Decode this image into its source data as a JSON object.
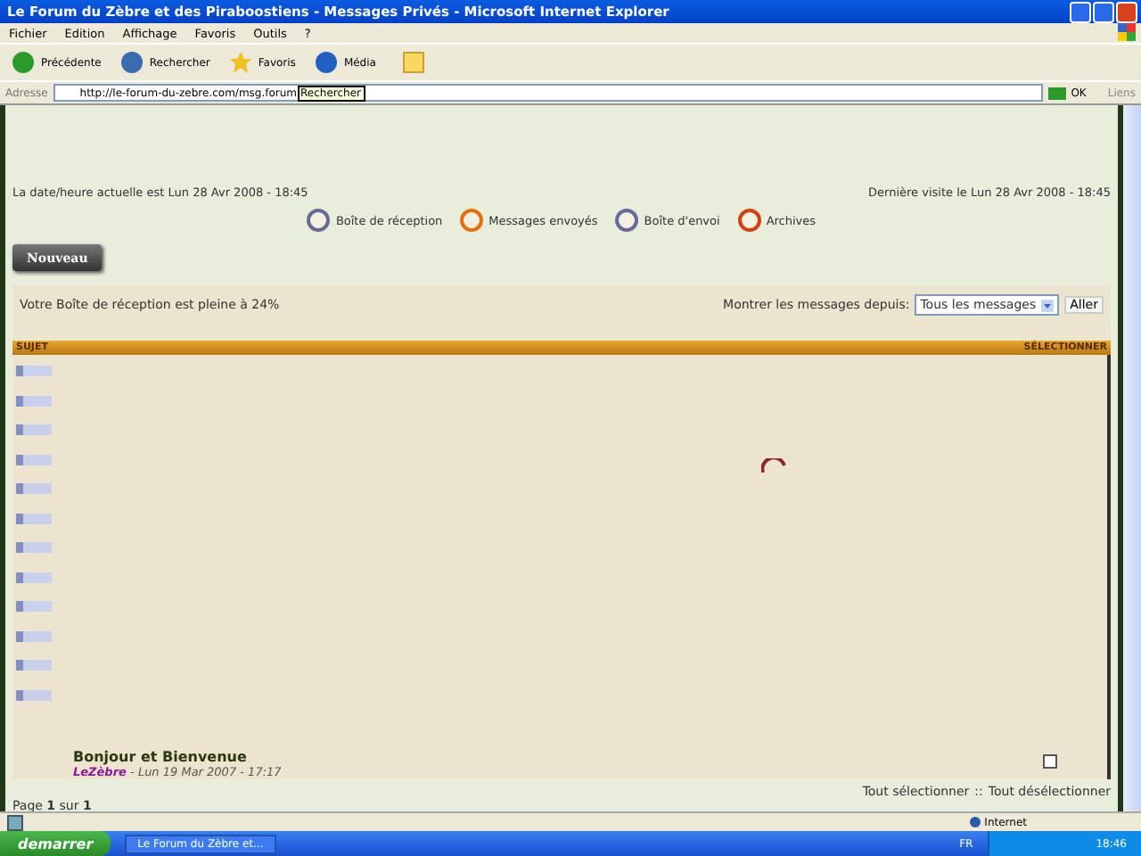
{
  "window": {
    "title": "Le Forum du Zèbre et des Piraboostiens - Messages Privés - Microsoft Internet Explorer"
  },
  "menu": [
    "Fichier",
    "Edition",
    "Affichage",
    "Favoris",
    "Outils",
    "?"
  ],
  "toolbar": [
    {
      "kind": "back",
      "label": "Précédente"
    },
    {
      "kind": "search",
      "label": "Rechercher"
    },
    {
      "kind": "favorites",
      "label": "Favoris"
    },
    {
      "kind": "media",
      "label": "Média"
    }
  ],
  "address": {
    "label": "Adresse",
    "value": "http://le-forum-du-zebre.com/msg.forum",
    "tooltip": "Rechercher",
    "go": "OK",
    "links": "Liens"
  },
  "page": {
    "current_date": "La date/heure actuelle est Lun 28 Avr 2008 - 18:45",
    "last_visit": "Dernière visite le Lun 28 Avr 2008 - 18:45",
    "nav": [
      {
        "kind": "inbox",
        "label": "Boîte de réception"
      },
      {
        "kind": "sent",
        "label": "Messages envoyés"
      },
      {
        "kind": "outbox",
        "label": "Boîte d'envoi"
      },
      {
        "kind": "archive",
        "label": "Archives"
      }
    ],
    "new_button": "Nouveau",
    "quota": "Votre Boîte de réception est pleine à 24%",
    "filter_label": "Montrer les messages depuis:",
    "filter_value": "Tous les messages",
    "filter_button": "Aller",
    "columns": [
      "SUJET",
      "SÉLECTIONNER"
    ],
    "message": {
      "subject": "Bonjour et Bienvenue",
      "author": "LeZèbre",
      "date": "- Lun 19 Mar 2007 - 17:17",
      "checked": false
    },
    "select_all": "Tout sélectionner",
    "separator": "::",
    "deselect_all": "Tout désélectionner",
    "pagination": "Page **1** sur **1**"
  },
  "status_bar": {
    "zone": "Internet"
  },
  "taskbar": {
    "start": "demarrer",
    "task": "Le Forum du Zèbre et...",
    "lang": "FR",
    "clock": "18:46"
  }
}
